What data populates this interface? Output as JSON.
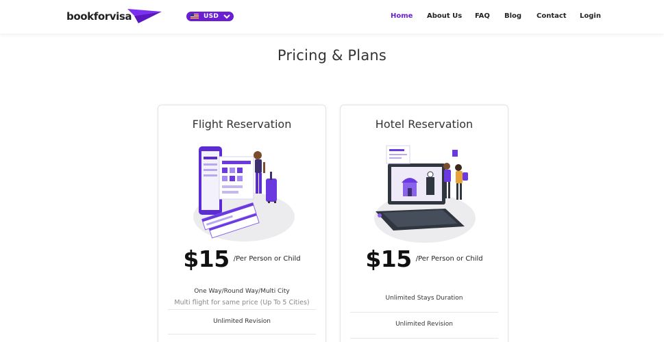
{
  "brand": {
    "name": "bookforvisa",
    "accent": "#6a1fd1"
  },
  "currency": {
    "label": "USD",
    "flag": "us-flag-icon"
  },
  "nav": {
    "home": "Home",
    "about": "About Us",
    "faq": "FAQ",
    "blog": "Blog",
    "contact": "Contact",
    "login": "Login"
  },
  "page": {
    "title": "Pricing & Plans"
  },
  "plans": [
    {
      "title": "Flight Reservation",
      "price": "$15",
      "per": "/Per Person or Child",
      "feature_1": "One Way/Round Way/Multi City",
      "feature_1_sub": "Multi flight for same price (Up To 5 Cities)",
      "feature_2": "Unlimited Revision"
    },
    {
      "title": "Hotel Reservation",
      "price": "$15",
      "per": "/Per Person or Child",
      "feature_1": "Unlimited Stays Duration",
      "feature_2": "Unlimited Revision"
    }
  ]
}
